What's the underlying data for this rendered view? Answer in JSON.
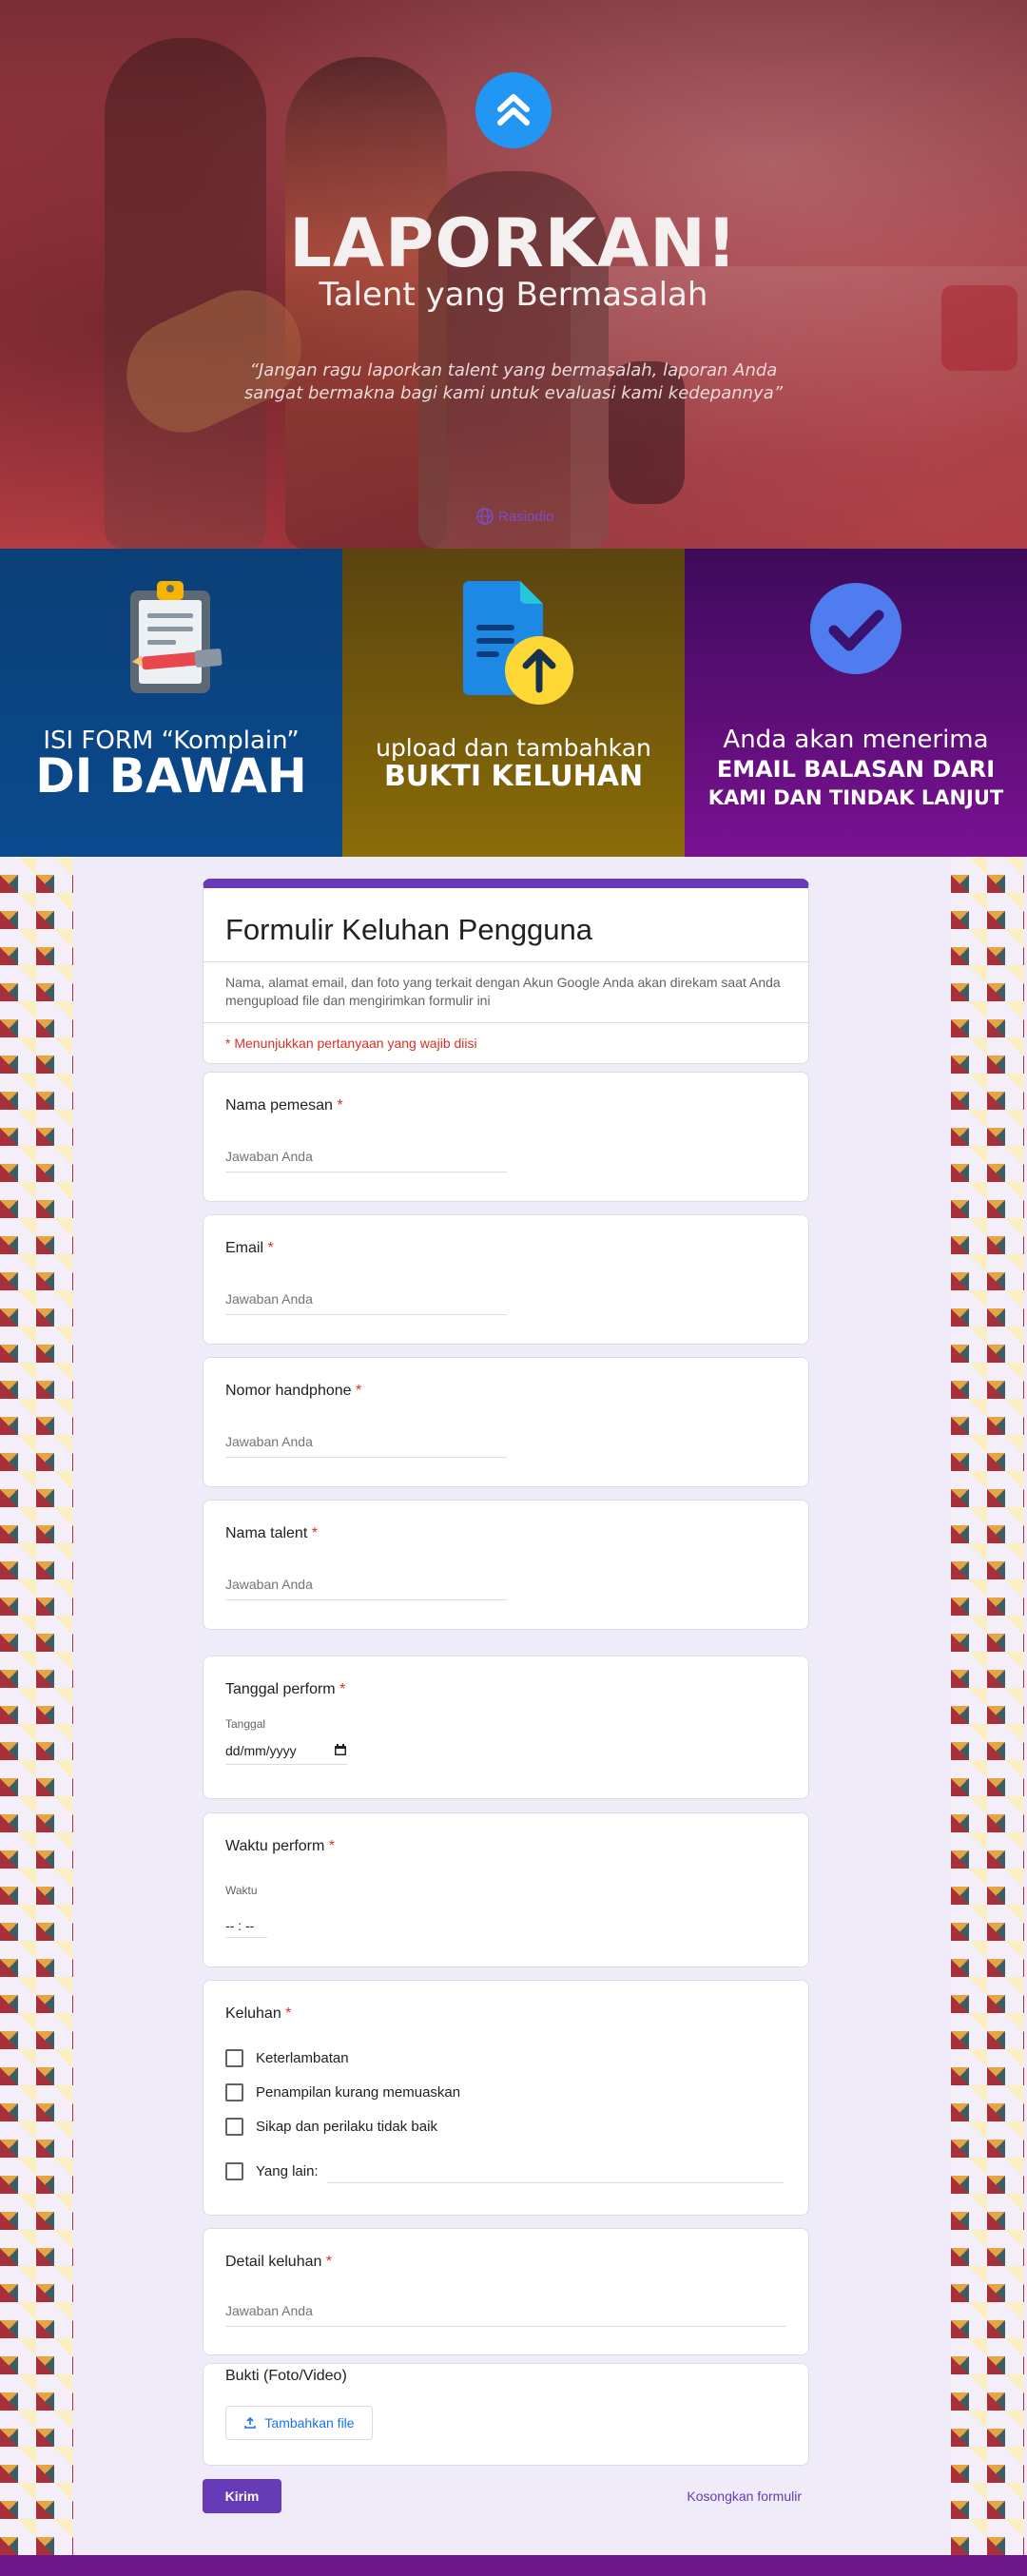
{
  "hero": {
    "title": "LAPORKAN!",
    "subtitle": "Talent yang Bermasalah",
    "quote": "“Jangan ragu laporkan talent yang bermasalah, laporan Anda sangat bermakna bagi kami untuk evaluasi kami kedepannya”",
    "brand": "Rasiodio",
    "logo_icon": "double-chevron-up-icon"
  },
  "steps": [
    {
      "line1": "ISI FORM “Komplain”",
      "line2": "DI BAWAH",
      "icon": "clipboard-icon",
      "color": "#0b4280"
    },
    {
      "line1": "upload dan tambahkan",
      "line2": "BUKTI KELUHAN",
      "icon": "file-upload-icon",
      "color": "#7a5d0c"
    },
    {
      "line1": "Anda akan menerima",
      "line2": "EMAIL BALASAN DARI",
      "line3": "KAMI DAN TINDAK LANJUT",
      "icon": "check-circle-icon",
      "color": "#5d0f7a"
    }
  ],
  "form": {
    "title": "Formulir Keluhan Pengguna",
    "description": "Nama, alamat email, dan foto yang terkait dengan Akun Google Anda akan direkam saat Anda mengupload file dan mengirimkan formulir ini",
    "required_note": "* Menunjukkan pertanyaan yang wajib diisi",
    "accent": "#673ab7",
    "questions": {
      "nama": {
        "label": "Nama pemesan",
        "placeholder": "Jawaban Anda"
      },
      "email": {
        "label": "Email",
        "placeholder": "Jawaban Anda"
      },
      "hp": {
        "label": "Nomor handphone",
        "placeholder": "Jawaban Anda"
      },
      "talent": {
        "label": "Nama talent",
        "placeholder": "Jawaban Anda"
      },
      "tanggal": {
        "label": "Tanggal perform",
        "sublabel": "Tanggal",
        "value": "dd/mm/yyyy"
      },
      "waktu": {
        "label": "Waktu perform",
        "sublabel": "Waktu",
        "value": "-- : --"
      },
      "keluhan": {
        "label": "Keluhan",
        "options": [
          "Keterlambatan",
          "Penampilan kurang memuaskan",
          "Sikap dan perilaku tidak baik",
          "Yang lain:"
        ]
      },
      "detail": {
        "label": "Detail keluhan",
        "placeholder": "Jawaban Anda"
      },
      "bukti": {
        "label": "Bukti (Foto/Video)",
        "button": "Tambahkan file"
      }
    },
    "required_star": "*",
    "submit": "Kirim",
    "clear": "Kosongkan formulir"
  }
}
